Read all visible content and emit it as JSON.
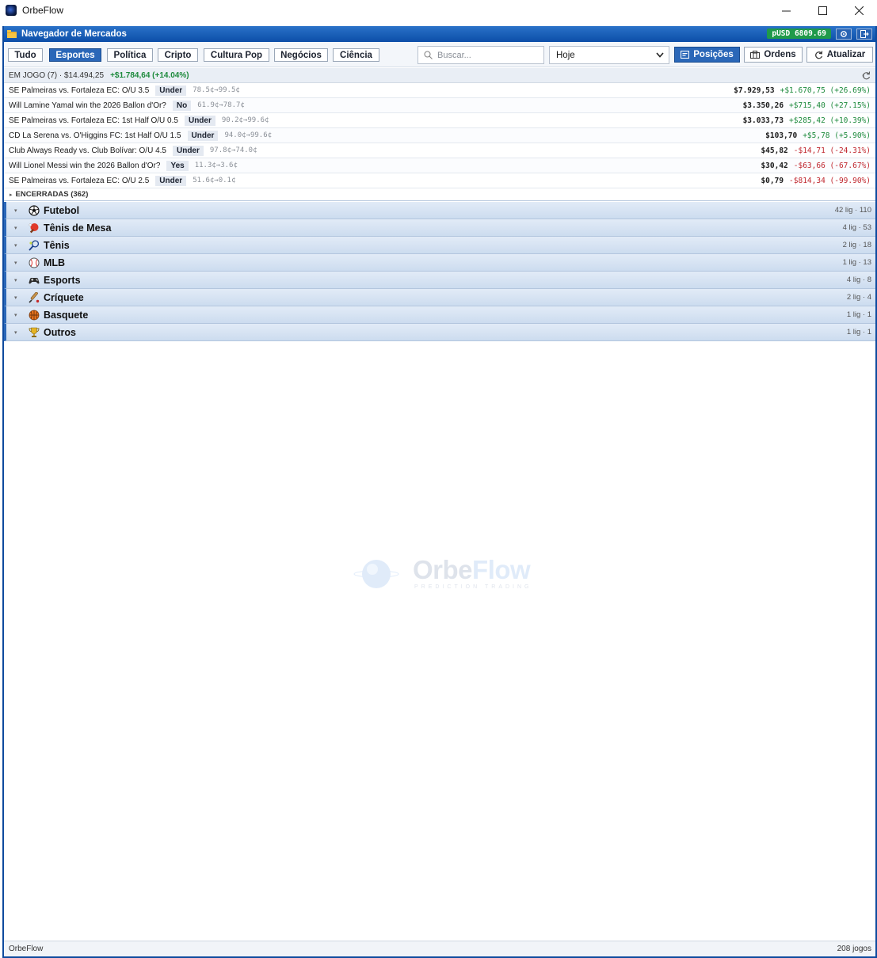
{
  "window": {
    "title": "OrbeFlow"
  },
  "panel": {
    "title": "Navegador de Mercados",
    "balance": "pUSD 6809.69"
  },
  "categories": [
    {
      "label": "Tudo",
      "active": false
    },
    {
      "label": "Esportes",
      "active": true
    },
    {
      "label": "Política",
      "active": false
    },
    {
      "label": "Cripto",
      "active": false
    },
    {
      "label": "Cultura Pop",
      "active": false
    },
    {
      "label": "Negócios",
      "active": false
    },
    {
      "label": "Ciência",
      "active": false
    }
  ],
  "search": {
    "placeholder": "Buscar...",
    "value": ""
  },
  "date_filter": {
    "selected": "Hoje"
  },
  "toolbar": {
    "positions_label": "Posições",
    "orders_label": "Ordens",
    "refresh_label": "Atualizar"
  },
  "in_play": {
    "label": "EM JOGO (7) · $14.494,25",
    "pnl": "+$1.784,64 (+14.04%)"
  },
  "positions": [
    {
      "name": "SE Palmeiras vs. Fortaleza EC: O/U 3.5",
      "side": "Under",
      "price": "78.5¢→99.5¢",
      "value": "$7.929,53",
      "pnl": "+$1.670,75 (+26.69%)",
      "positive": true
    },
    {
      "name": "Will Lamine Yamal win the 2026 Ballon d'Or?",
      "side": "No",
      "price": "61.9¢→78.7¢",
      "value": "$3.350,26",
      "pnl": "+$715,40 (+27.15%)",
      "positive": true
    },
    {
      "name": "SE Palmeiras vs. Fortaleza EC: 1st Half O/U 0.5",
      "side": "Under",
      "price": "90.2¢→99.6¢",
      "value": "$3.033,73",
      "pnl": "+$285,42 (+10.39%)",
      "positive": true
    },
    {
      "name": "CD La Serena vs. O'Higgins FC: 1st Half O/U 1.5",
      "side": "Under",
      "price": "94.0¢→99.6¢",
      "value": "$103,70",
      "pnl": "+$5,78 (+5.90%)",
      "positive": true
    },
    {
      "name": "Club Always Ready vs. Club Bolívar: O/U 4.5",
      "side": "Under",
      "price": "97.8¢→74.0¢",
      "value": "$45,82",
      "pnl": "-$14,71 (-24.31%)",
      "positive": false
    },
    {
      "name": "Will Lionel Messi win the 2026 Ballon d'Or?",
      "side": "Yes",
      "price": "11.3¢→3.6¢",
      "value": "$30,42",
      "pnl": "-$63,66 (-67.67%)",
      "positive": false
    },
    {
      "name": "SE Palmeiras vs. Fortaleza EC: O/U 2.5",
      "side": "Under",
      "price": "51.6¢→0.1¢",
      "value": "$0,79",
      "pnl": "-$814,34 (-99.90%)",
      "positive": false
    }
  ],
  "closed": {
    "label": "ENCERRADAS (362)"
  },
  "sports": [
    {
      "name": "Futebol",
      "icon": "soccer-ball-icon",
      "count": "42 lig · 110"
    },
    {
      "name": "Tênis de Mesa",
      "icon": "ping-pong-icon",
      "count": "4 lig · 53"
    },
    {
      "name": "Tênis",
      "icon": "tennis-racket-icon",
      "count": "2 lig · 18"
    },
    {
      "name": "MLB",
      "icon": "baseball-icon",
      "count": "1 lig · 13"
    },
    {
      "name": "Esports",
      "icon": "gamepad-icon",
      "count": "4 lig · 8"
    },
    {
      "name": "Críquete",
      "icon": "cricket-bat-icon",
      "count": "2 lig · 4"
    },
    {
      "name": "Basquete",
      "icon": "basketball-icon",
      "count": "1 lig · 1"
    },
    {
      "name": "Outros",
      "icon": "trophy-icon",
      "count": "1 lig · 1"
    }
  ],
  "watermark": {
    "brand_a": "Orbe",
    "brand_b": "Flow",
    "tagline": "PREDICTION TRADING"
  },
  "status": {
    "left": "OrbeFlow",
    "right": "208 jogos"
  },
  "colors": {
    "accent": "#2a67b8",
    "positive": "#1d8a3c",
    "negative": "#c0262d",
    "balance_badge": "#1f9a4a"
  }
}
